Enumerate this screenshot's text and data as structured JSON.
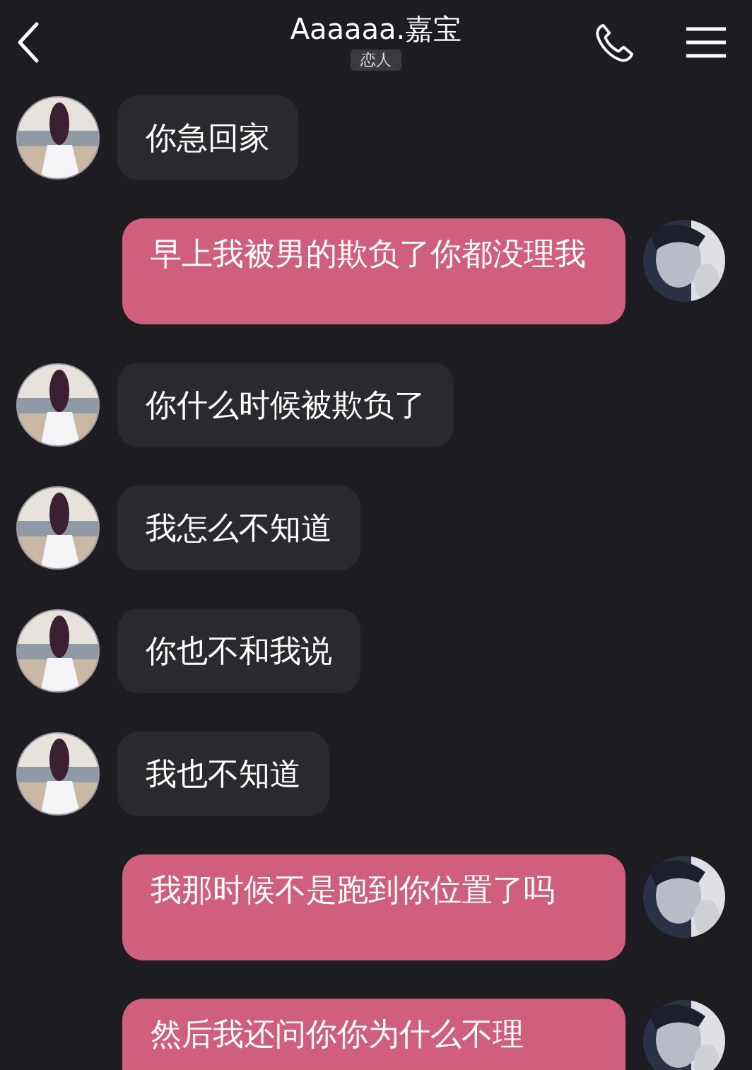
{
  "header": {
    "title": "Aaaaaa.嘉宝",
    "tag": "恋人"
  },
  "messages": [
    {
      "kind": "received",
      "text": "你急回家"
    },
    {
      "kind": "sent",
      "text": "早上我被男的欺负了你都没理我"
    },
    {
      "kind": "received",
      "text": "你什么时候被欺负了"
    },
    {
      "kind": "received",
      "text": "我怎么不知道"
    },
    {
      "kind": "received",
      "text": "你也不和我说"
    },
    {
      "kind": "received",
      "text": "我也不知道"
    },
    {
      "kind": "sent",
      "text": "我那时候不是跑到你位置了吗"
    },
    {
      "kind": "sent",
      "text": "然后我还问你你为什么不理"
    }
  ]
}
